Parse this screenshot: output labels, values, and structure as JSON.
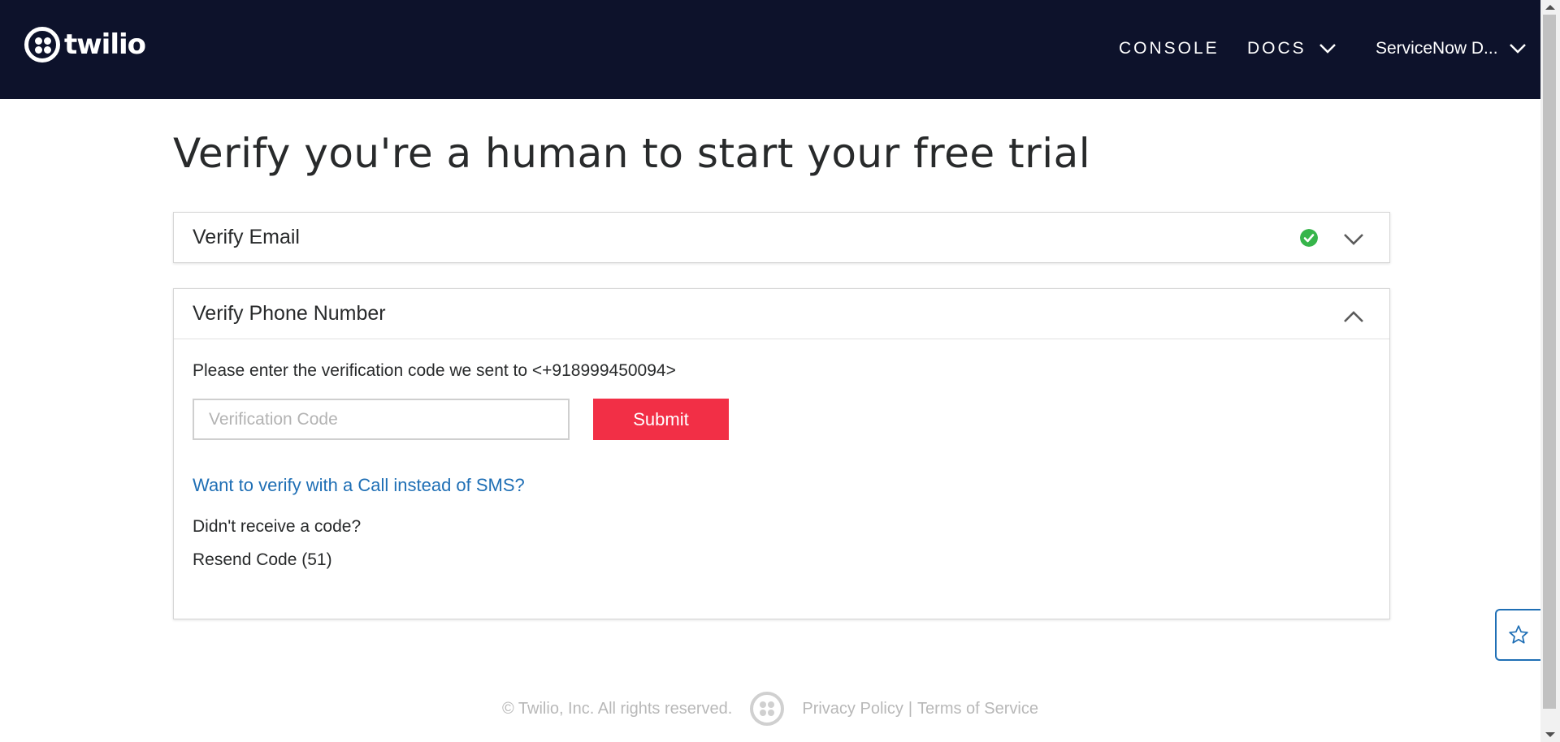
{
  "header": {
    "logo_text": "twilio",
    "nav": {
      "console_label": "CONSOLE",
      "docs_label": "DOCS",
      "account_label": "ServiceNow D..."
    }
  },
  "main": {
    "headline": "Verify you're a human to start your free trial",
    "email_panel": {
      "title": "Verify Email",
      "status_icon": "check-circle-icon",
      "status_color": "#36b54a",
      "toggle_icon": "chevron-down-icon"
    },
    "phone_panel": {
      "title": "Verify Phone Number",
      "toggle_icon": "chevron-up-icon",
      "prompt": "Please enter the verification code we sent to <+918999450094>",
      "code_input": {
        "value": "",
        "placeholder": "Verification Code"
      },
      "submit_label": "Submit",
      "call_link": "Want to verify with a Call instead of SMS?",
      "no_code_text": "Didn't receive a code?",
      "resend_text": "Resend Code (51)"
    }
  },
  "footer": {
    "copyright": "© Twilio, Inc. All rights reserved.",
    "privacy_label": "Privacy Policy",
    "separator": "|",
    "terms_label": "Terms of Service"
  },
  "floating": {
    "favorite_icon": "star-outline-icon"
  },
  "colors": {
    "nav_bg": "#0d122b",
    "accent": "#f22f46",
    "link": "#1f6fb5",
    "success": "#36b54a"
  }
}
